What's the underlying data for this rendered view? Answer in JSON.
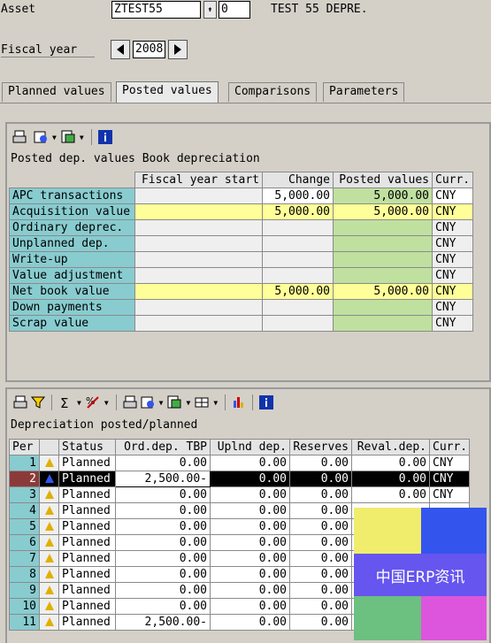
{
  "header": {
    "asset_label": "Asset",
    "asset_value": "ZTEST55",
    "subnumber": "0",
    "asset_description": "TEST 55 DEPRE.",
    "fiscal_year_label": "Fiscal year",
    "fiscal_year_value": "2008"
  },
  "tabs": [
    "Planned values",
    "Posted values",
    "Comparisons",
    "Parameters"
  ],
  "active_tab": "Posted values",
  "posted_panel": {
    "title": "Posted dep. values Book depreciation",
    "columns": [
      "",
      "Fiscal year start",
      "Change",
      "Posted values",
      "Curr."
    ],
    "rows": [
      {
        "label": "APC transactions",
        "start": "",
        "change": "5,000.00",
        "posted": "5,000.00",
        "curr": "CNY"
      },
      {
        "label": "Acquisition value",
        "start": "",
        "change": "5,000.00",
        "posted": "5,000.00",
        "curr": "CNY"
      },
      {
        "label": "Ordinary deprec.",
        "start": "",
        "change": "",
        "posted": "",
        "curr": "CNY"
      },
      {
        "label": "Unplanned dep.",
        "start": "",
        "change": "",
        "posted": "",
        "curr": "CNY"
      },
      {
        "label": "Write-up",
        "start": "",
        "change": "",
        "posted": "",
        "curr": "CNY"
      },
      {
        "label": "Value adjustment",
        "start": "",
        "change": "",
        "posted": "",
        "curr": "CNY"
      },
      {
        "label": "Net book value",
        "start": "",
        "change": "5,000.00",
        "posted": "5,000.00",
        "curr": "CNY"
      },
      {
        "label": "Down payments",
        "start": "",
        "change": "",
        "posted": "",
        "curr": "CNY"
      },
      {
        "label": "Scrap value",
        "start": "",
        "change": "",
        "posted": "",
        "curr": "CNY"
      }
    ]
  },
  "dep_panel": {
    "title": "Depreciation posted/planned",
    "columns": [
      "Per",
      "",
      "Status",
      "Ord.dep. TBP",
      "Uplnd dep.",
      "Reserves",
      "Reval.dep.",
      "Curr."
    ],
    "rows": [
      {
        "per": "1",
        "status": "Planned",
        "ord": "0.00",
        "upl": "0.00",
        "res": "0.00",
        "reval": "0.00",
        "curr": "CNY"
      },
      {
        "per": "2",
        "status": "Planned",
        "ord": "2,500.00-",
        "upl": "0.00",
        "res": "0.00",
        "reval": "0.00",
        "curr": "CNY"
      },
      {
        "per": "3",
        "status": "Planned",
        "ord": "0.00",
        "upl": "0.00",
        "res": "0.00",
        "reval": "0.00",
        "curr": "CNY"
      },
      {
        "per": "4",
        "status": "Planned",
        "ord": "0.00",
        "upl": "0.00",
        "res": "0.00",
        "reval": "",
        "curr": ""
      },
      {
        "per": "5",
        "status": "Planned",
        "ord": "0.00",
        "upl": "0.00",
        "res": "0.00",
        "reval": "",
        "curr": ""
      },
      {
        "per": "6",
        "status": "Planned",
        "ord": "0.00",
        "upl": "0.00",
        "res": "0.00",
        "reval": "",
        "curr": ""
      },
      {
        "per": "7",
        "status": "Planned",
        "ord": "0.00",
        "upl": "0.00",
        "res": "0.00",
        "reval": "",
        "curr": ""
      },
      {
        "per": "8",
        "status": "Planned",
        "ord": "0.00",
        "upl": "0.00",
        "res": "0.00",
        "reval": "",
        "curr": ""
      },
      {
        "per": "9",
        "status": "Planned",
        "ord": "0.00",
        "upl": "0.00",
        "res": "0.00",
        "reval": "",
        "curr": ""
      },
      {
        "per": "10",
        "status": "Planned",
        "ord": "0.00",
        "upl": "0.00",
        "res": "0.00",
        "reval": "",
        "curr": ""
      },
      {
        "per": "11",
        "status": "Planned",
        "ord": "2,500.00-",
        "upl": "0.00",
        "res": "0.00",
        "reval": "",
        "curr": ""
      }
    ]
  },
  "watermark": {
    "text": "中国ERP资讯",
    "colors": [
      "#f0ec6c",
      "#3355ee",
      "#6655ee",
      "#6cc080",
      "#dd55dd"
    ]
  },
  "icons": {
    "toolbar1": [
      "print-icon",
      "layout-icon",
      "export-icon",
      "info-icon"
    ],
    "toolbar2": [
      "print-icon",
      "filter-icon",
      "sum-icon",
      "subtotal-icon",
      "print-preview-icon",
      "export-icon",
      "layout-icon",
      "graphic-icon",
      "info-icon"
    ]
  }
}
